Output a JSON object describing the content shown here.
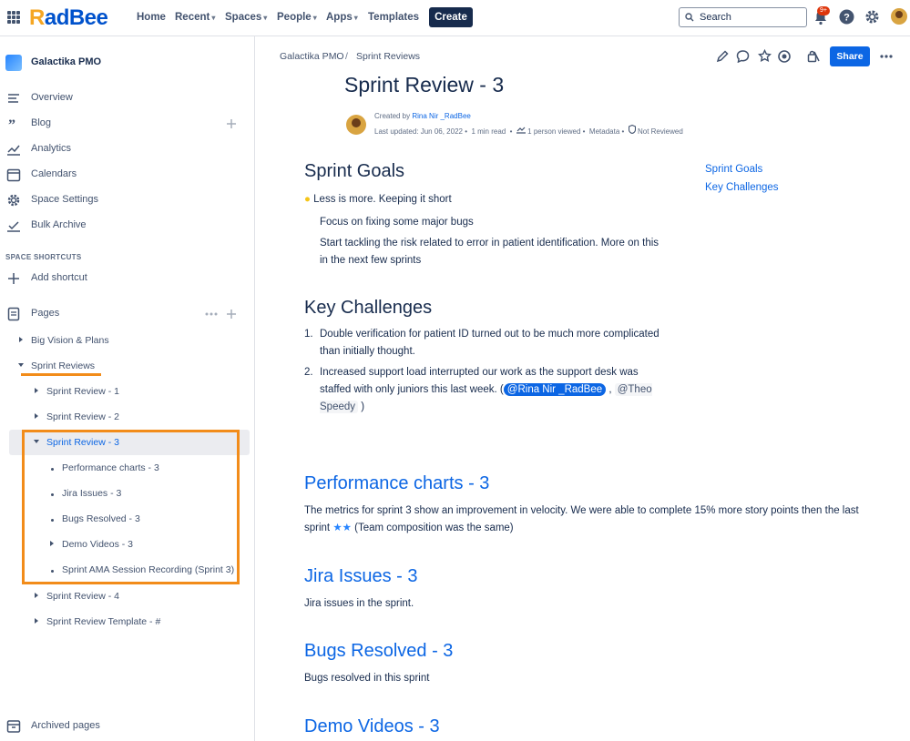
{
  "topbar": {
    "logo": "RadBee",
    "nav": [
      "Home",
      "Recent",
      "Spaces",
      "People",
      "Apps",
      "Templates"
    ],
    "create": "Create",
    "search_placeholder": "Search",
    "notif_badge": "9+"
  },
  "sidebar": {
    "space_name": "Galactika PMO",
    "items": [
      "Overview",
      "Blog",
      "Analytics",
      "Calendars",
      "Space Settings",
      "Bulk Archive"
    ],
    "shortcuts_header": "SPACE SHORTCUTS",
    "add_shortcut": "Add shortcut",
    "pages": "Pages",
    "tree": {
      "big_vision": "Big Vision & Plans",
      "sprint_reviews": "Sprint Reviews",
      "sr1": "Sprint Review - 1",
      "sr2": "Sprint Review - 2",
      "sr3": "Sprint Review - 3",
      "children": [
        "Performance charts - 3",
        "Jira Issues - 3",
        "Bugs Resolved - 3",
        "Demo Videos - 3",
        "Sprint AMA Session Recording (Sprint 3)"
      ],
      "sr4": "Sprint Review - 4",
      "template": "Sprint Review Template - #"
    },
    "archived": "Archived pages"
  },
  "page": {
    "breadcrumb": [
      "Galactika PMO",
      "Sprint Reviews"
    ],
    "share": "Share",
    "title": "Sprint Review - 3",
    "created_prefix": "Created by ",
    "author": "Rina Nir _RadBee",
    "last_updated": "Last updated: Jun 06, 2022",
    "read_time": "1 min read",
    "viewed": "1 person viewed",
    "metadata": "Metadata",
    "review_status": "Not Reviewed",
    "sections": {
      "goals_title": "Sprint Goals",
      "goals_1": "Less is more. Keeping it short",
      "goals_2": "Focus on fixing some major bugs",
      "goals_3": "Start tackling the risk related to error in patient identification. More on this in the next few sprints",
      "challenges_title": "Key Challenges",
      "ch_1": "Double verification for patient ID turned out to be much more complicated than initially thought.",
      "ch_2_a": "Increased support load interrupted our work as the support desk was staffed with only juniors this last week. (",
      "ch_2_m1": "@Rina Nir _RadBee",
      "ch_2_m2": "@Theo Speedy",
      "perf_title": "Performance charts - 3",
      "perf_text_a": "The metrics for sprint 3 show an improvement in velocity. We were able to complete 15% more story points then the last sprint",
      "perf_text_b": "(Team composition was the same)",
      "jira_title": "Jira Issues - 3",
      "jira_text": "Jira issues in the sprint.",
      "bugs_title": "Bugs Resolved - 3",
      "bugs_text": "Bugs resolved in this sprint",
      "demo_title": "Demo Videos - 3"
    },
    "toc": [
      "Sprint Goals",
      "Key Challenges"
    ]
  }
}
